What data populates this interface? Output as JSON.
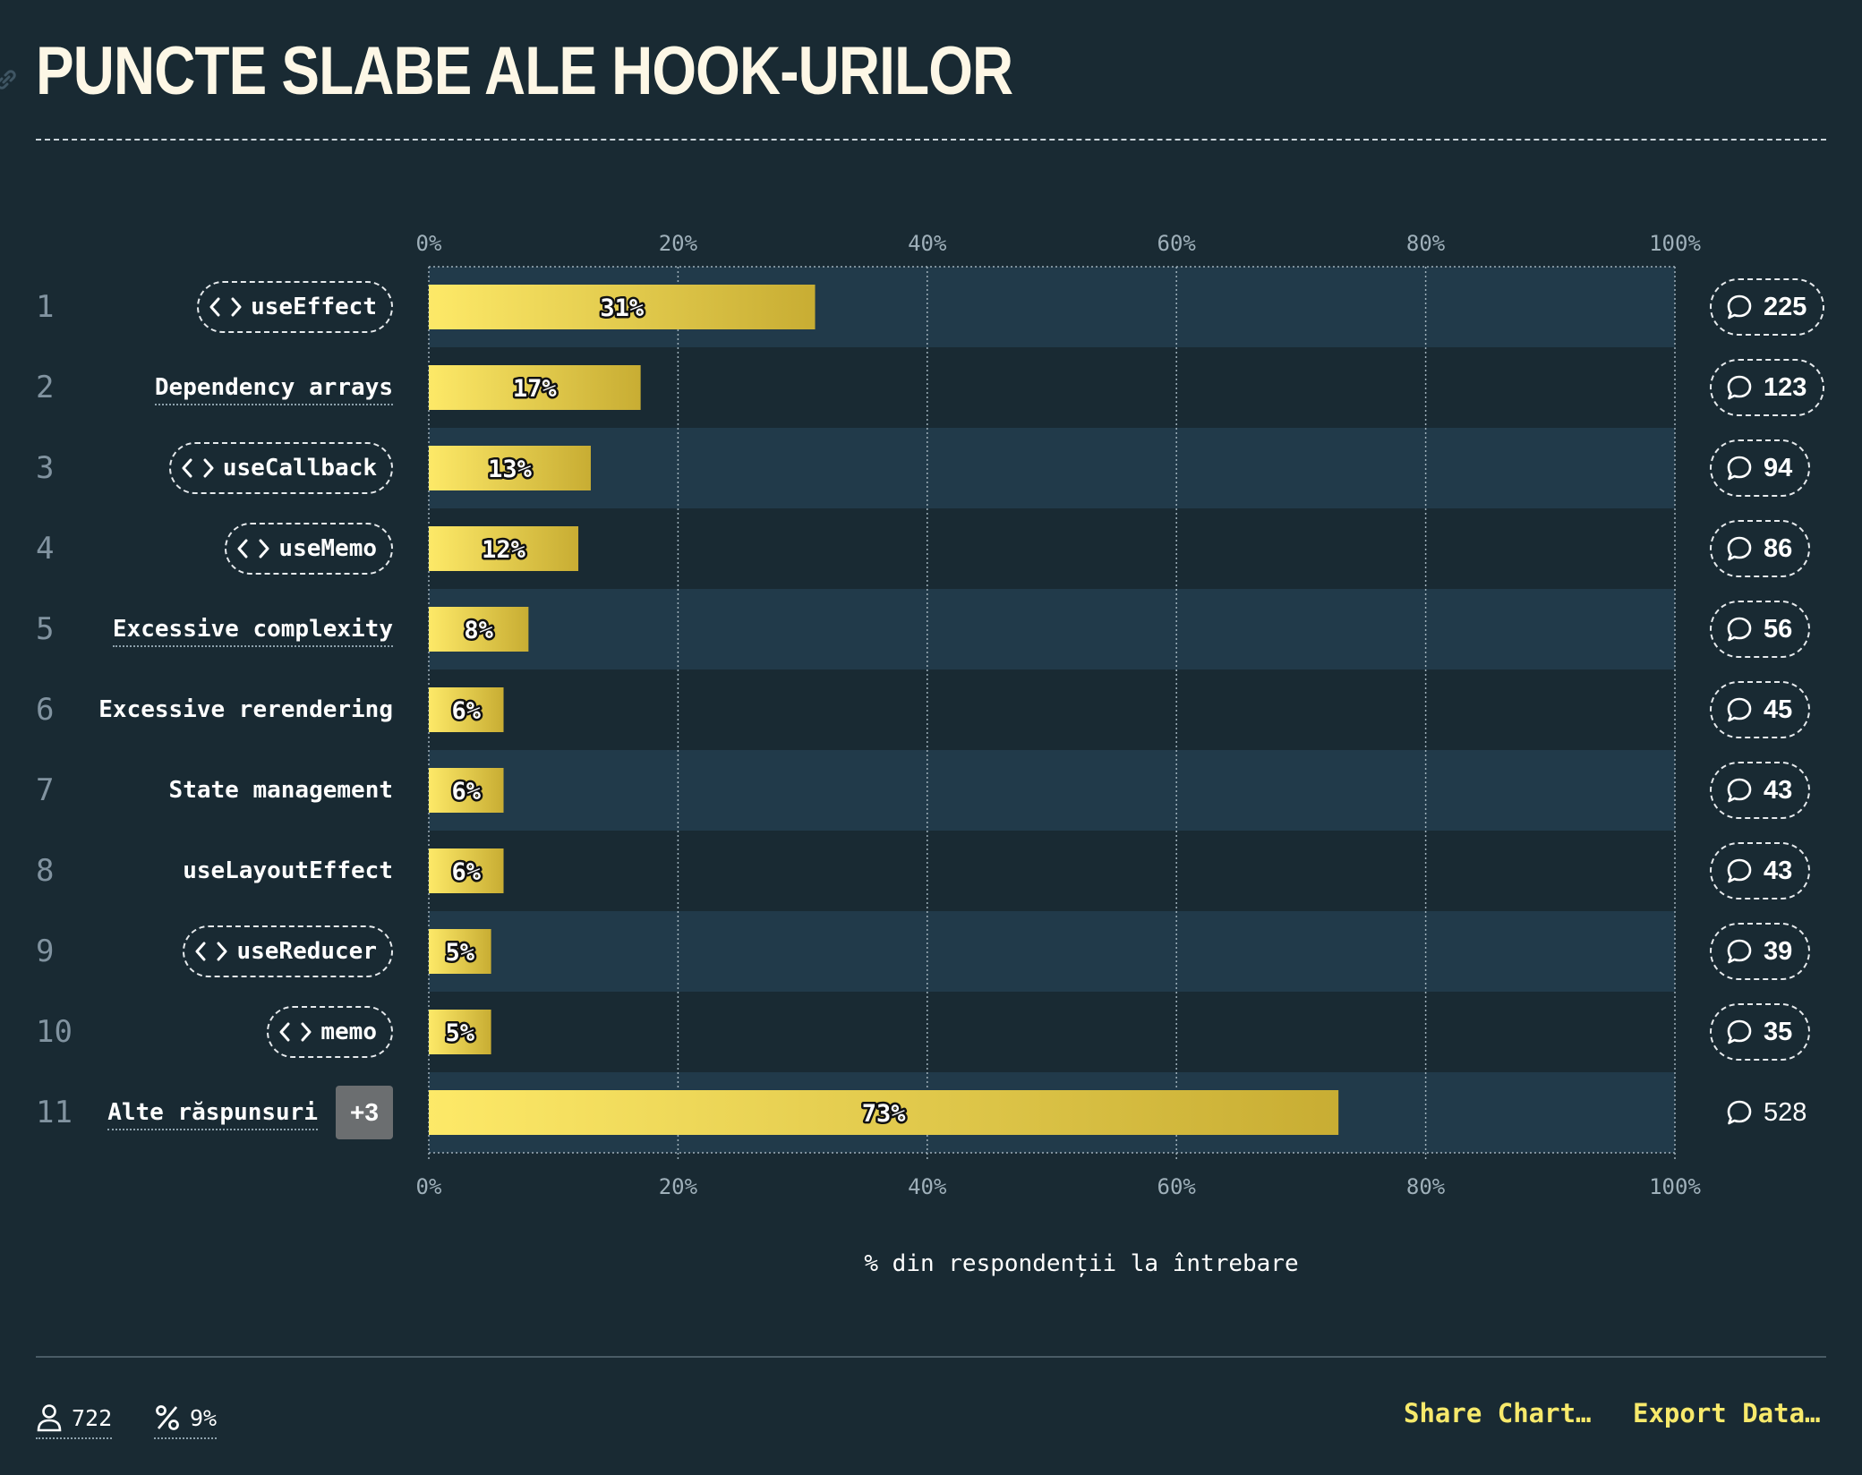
{
  "header": {
    "title": "PUNCTE SLABE ALE HOOK-URILOR"
  },
  "chart_data": {
    "type": "bar",
    "orientation": "horizontal",
    "title": "PUNCTE SLABE ALE HOOK-URILOR",
    "xlabel": "% din respondenții la întrebare",
    "xlim": [
      0,
      100
    ],
    "x_ticks": [
      "0%",
      "20%",
      "40%",
      "60%",
      "80%",
      "100%"
    ],
    "grid": true,
    "rows": [
      {
        "rank": "1",
        "label": "useEffect",
        "kind": "code",
        "value": 31,
        "value_label": "31%",
        "count": "225"
      },
      {
        "rank": "2",
        "label": "Dependency arrays",
        "kind": "text",
        "value": 17,
        "value_label": "17%",
        "count": "123"
      },
      {
        "rank": "3",
        "label": "useCallback",
        "kind": "code",
        "value": 13,
        "value_label": "13%",
        "count": "94"
      },
      {
        "rank": "4",
        "label": "useMemo",
        "kind": "code",
        "value": 12,
        "value_label": "12%",
        "count": "86"
      },
      {
        "rank": "5",
        "label": "Excessive complexity",
        "kind": "text",
        "value": 8,
        "value_label": "8%",
        "count": "56"
      },
      {
        "rank": "6",
        "label": "Excessive rerendering",
        "kind": "plain",
        "value": 6,
        "value_label": "6%",
        "count": "45"
      },
      {
        "rank": "7",
        "label": "State management",
        "kind": "plain",
        "value": 6,
        "value_label": "6%",
        "count": "43"
      },
      {
        "rank": "8",
        "label": "useLayoutEffect",
        "kind": "plain",
        "value": 6,
        "value_label": "6%",
        "count": "43"
      },
      {
        "rank": "9",
        "label": "useReducer",
        "kind": "code",
        "value": 5,
        "value_label": "5%",
        "count": "39"
      },
      {
        "rank": "10",
        "label": "memo",
        "kind": "code",
        "value": 5,
        "value_label": "5%",
        "count": "35"
      },
      {
        "rank": "11",
        "label": "Alte răspunsuri",
        "kind": "other",
        "badge": "+3",
        "value": 73,
        "value_label": "73%",
        "count": "528"
      }
    ]
  },
  "footer": {
    "respondents": "722",
    "percent": "9%",
    "share_label": "Share Chart…",
    "export_label": "Export Data…"
  },
  "colors": {
    "background": "#192a33",
    "row_band": "#213a4a",
    "bar_start": "#fde968",
    "bar_end": "#c8ad33",
    "accent": "#f7e96b"
  }
}
